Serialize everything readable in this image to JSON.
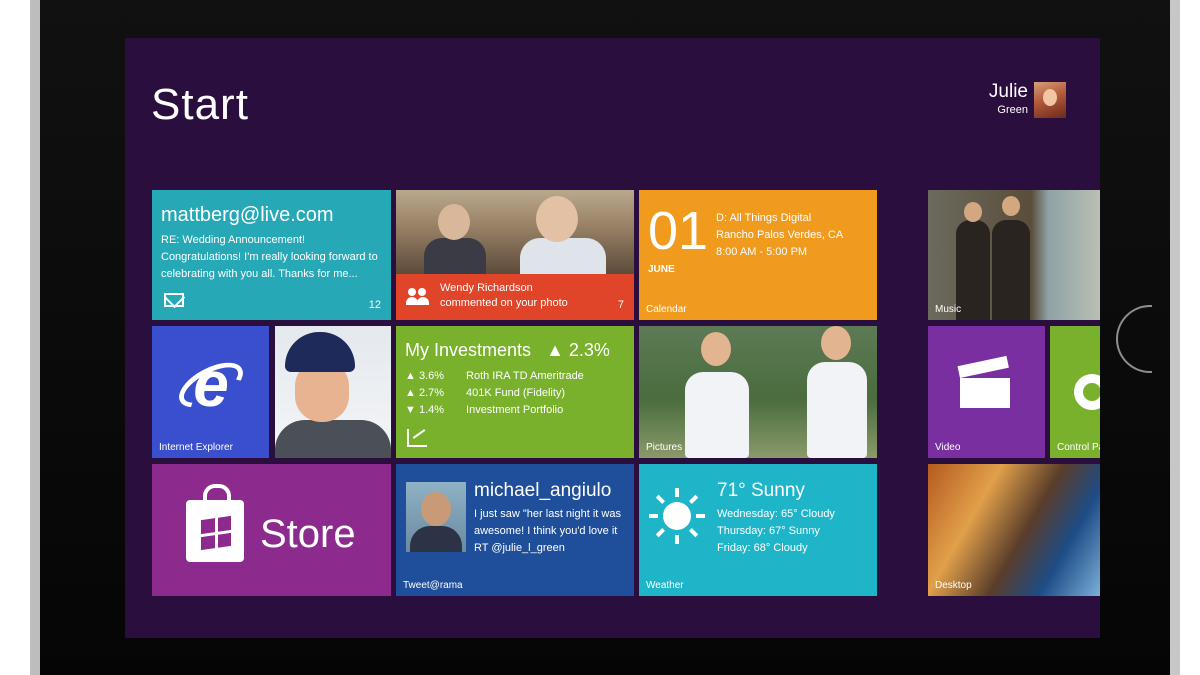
{
  "screen": {
    "title": "Start",
    "user": {
      "first_name": "Julie",
      "last_name": "Green"
    }
  },
  "tiles": {
    "mail": {
      "address": "mattberg@live.com",
      "subject": "RE: Wedding Announcement!",
      "preview": "Congratulations! I'm really looking forward to celebrating with you all. Thanks for me...",
      "count": "12"
    },
    "people": {
      "notification": "Wendy Richardson commented on your photo",
      "count": "7"
    },
    "calendar": {
      "day": "01",
      "month": "JUNE",
      "event_title": "D: All Things Digital",
      "event_location": "Rancho Palos Verdes, CA",
      "event_time": "8:00 AM - 5:00 PM",
      "name": "Calendar"
    },
    "music": {
      "name": "Music"
    },
    "internet_explorer": {
      "name": "Internet Explorer"
    },
    "investments": {
      "title": "My Investments",
      "change": "▲ 2.3%",
      "rows": [
        {
          "arrow": "▲",
          "pct": "3.6%",
          "label": "Roth IRA TD Ameritrade"
        },
        {
          "arrow": "▲",
          "pct": "2.7%",
          "label": "401K Fund (Fidelity)"
        },
        {
          "arrow": "▼",
          "pct": "1.4%",
          "label": "Investment Portfolio"
        }
      ]
    },
    "pictures": {
      "name": "Pictures"
    },
    "video": {
      "name": "Video"
    },
    "control_panel": {
      "name": "Control Pa"
    },
    "store": {
      "label": "Store"
    },
    "tweet": {
      "handle": "michael_angiulo",
      "message": "I just saw \"her last night it was awesome! I think you'd love it RT @julie_l_green",
      "name": "Tweet@rama"
    },
    "weather": {
      "temp": "71° Sunny",
      "forecast": [
        "Wednesday: 65° Cloudy",
        "Thursday: 67° Sunny",
        "Friday: 68° Cloudy"
      ],
      "name": "Weather"
    },
    "desktop": {
      "name": "Desktop"
    }
  },
  "colors": {
    "screen_bg": "#2a0e3e",
    "mail": "#26a8b6",
    "people_banner": "#e0452a",
    "calendar": "#f09b1e",
    "ie": "#3a4fcd",
    "investments": "#79b12d",
    "video": "#7a2fa0",
    "store": "#8c2a8e",
    "tweet": "#1f4f9a",
    "weather": "#1fb5c9"
  }
}
